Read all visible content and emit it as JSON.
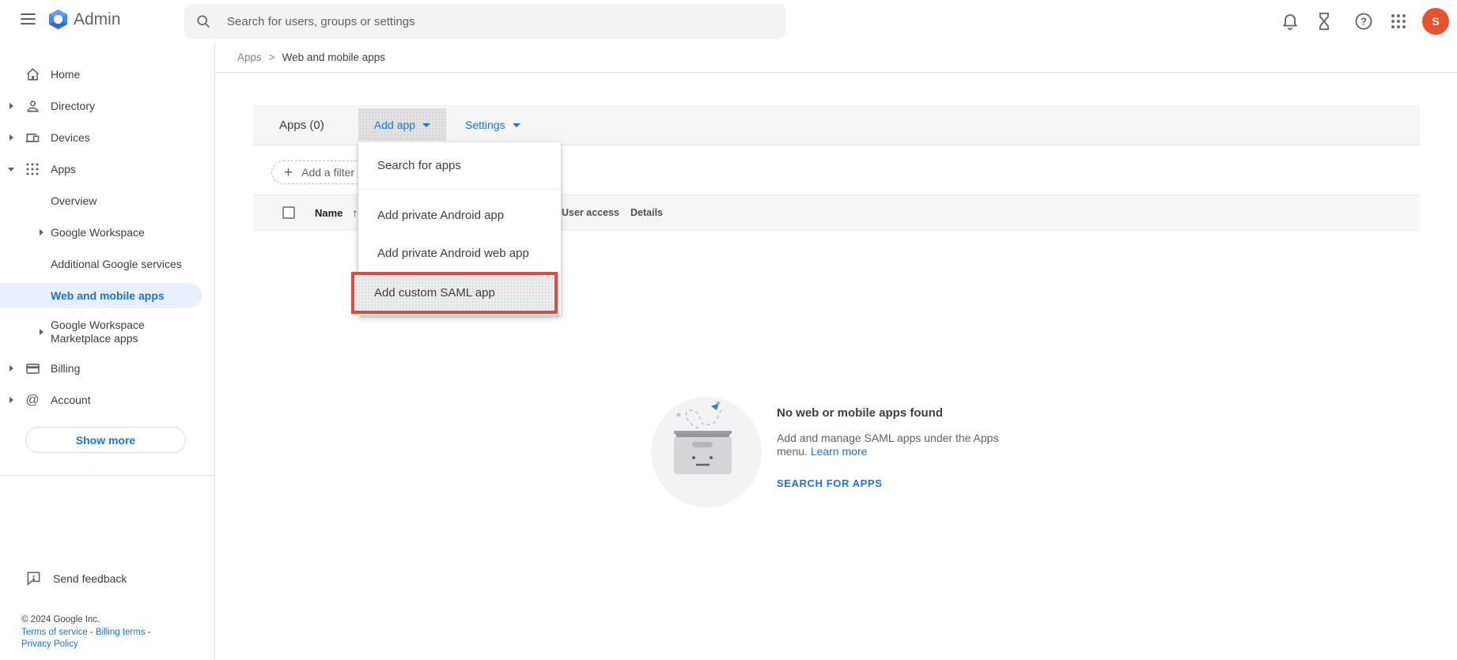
{
  "topbar": {
    "product": "Admin",
    "search": {
      "placeholder": "Search for users, groups or settings"
    },
    "avatar_initial": "S",
    "icon_names": [
      "notifications-bell-icon",
      "pending-tasks-hourglass-icon",
      "help-icon",
      "google-apps-grid-icon"
    ]
  },
  "sidebar": {
    "items": [
      {
        "label": "Home"
      },
      {
        "label": "Directory"
      },
      {
        "label": "Devices"
      },
      {
        "label": "Apps"
      },
      {
        "label": "Overview"
      },
      {
        "label": "Google Workspace"
      },
      {
        "label": "Additional Google services"
      },
      {
        "label": "Web and mobile apps",
        "active": true
      },
      {
        "label": "Google Workspace Marketplace apps"
      },
      {
        "label": "Billing"
      },
      {
        "label": "Account"
      }
    ],
    "show_more": "Show more",
    "send_feedback": "Send feedback",
    "footer": {
      "copyright": "© 2024 Google Inc.",
      "links": [
        "Terms of service",
        "Billing terms",
        "Privacy Policy"
      ],
      "separators": [
        " - ",
        " -"
      ]
    }
  },
  "breadcrumb": {
    "items": [
      "Apps",
      "Web and mobile apps"
    ],
    "separator": ">"
  },
  "toolbar": {
    "title": "Apps (0)",
    "add_app": "Add app",
    "settings": "Settings"
  },
  "filter": {
    "label": "Add a filter",
    "plus": "+"
  },
  "dropdown": {
    "items": [
      "Search for apps",
      "Add private Android app",
      "Add private Android web app",
      "Add custom SAML app"
    ],
    "highlighted": "Add custom SAML app"
  },
  "table": {
    "headers": [
      "Name",
      "User access",
      "Details"
    ],
    "sort_indicator": "↑",
    "sort_column": "Name"
  },
  "empty_state": {
    "title": "No web or mobile apps found",
    "body_line1": "Add and manage SAML apps under the Apps",
    "body_line2": "menu.",
    "learn_more": "Learn more",
    "cta": "SEARCH FOR APPS"
  },
  "colors": {
    "accent": "#1a73e8",
    "highlight_red": "#e3493c",
    "avatar_bg": "#e8532f",
    "active_item_bg": "#e8f0fe"
  }
}
